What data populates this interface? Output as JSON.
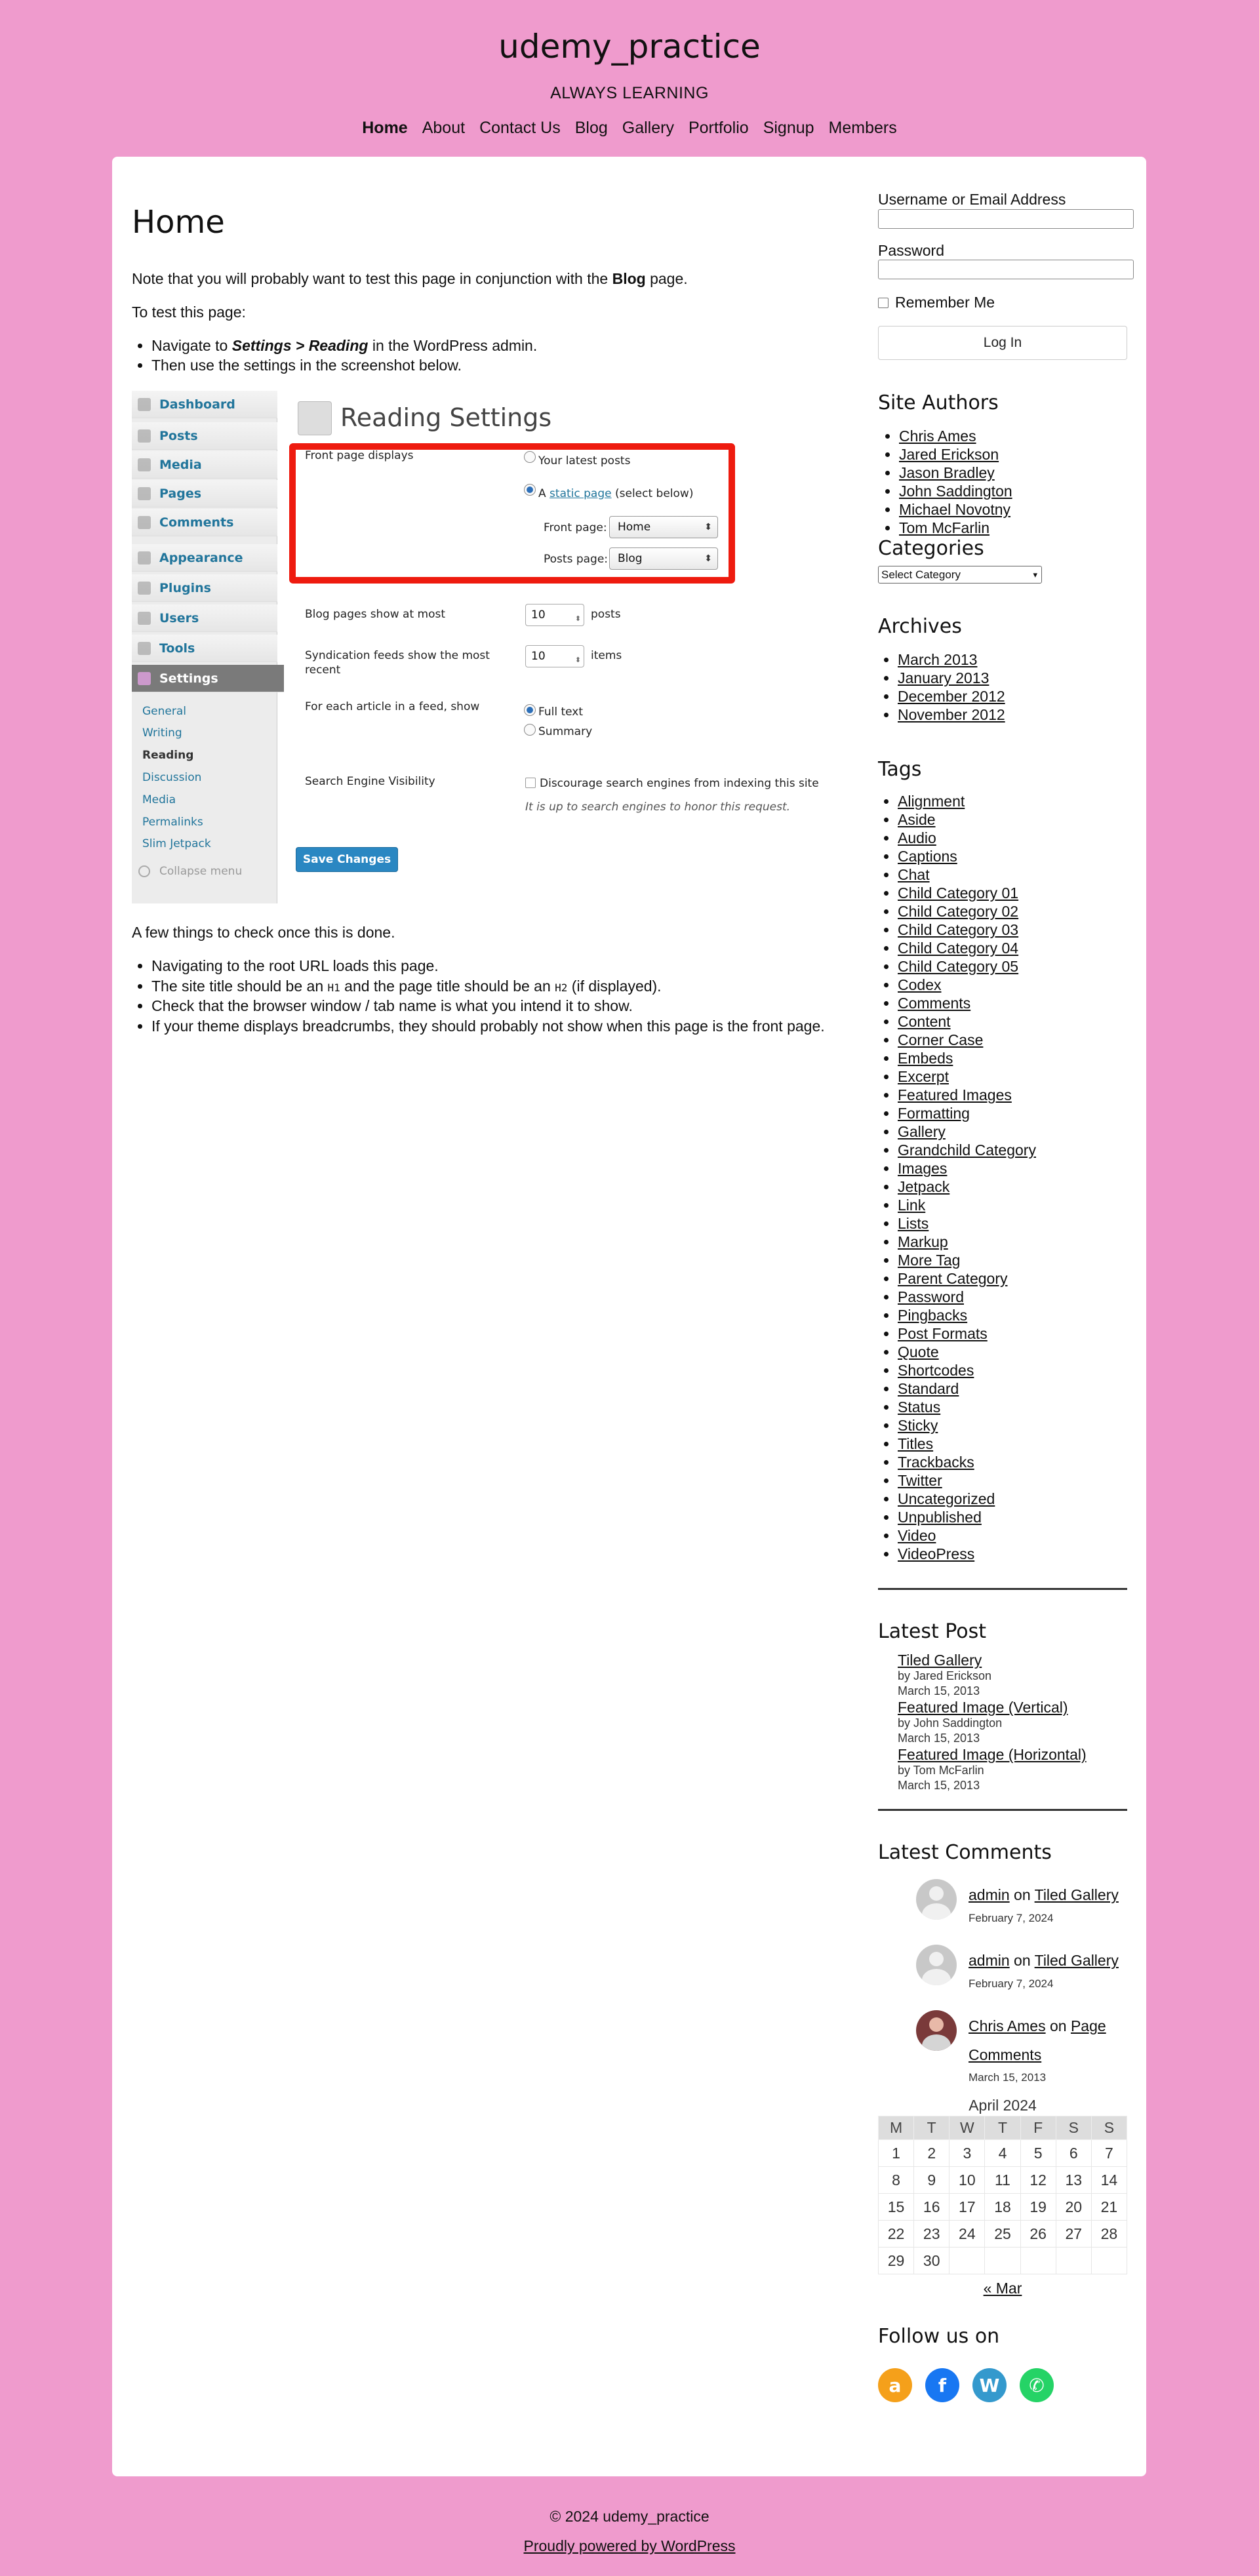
{
  "site": {
    "title": "udemy_practice",
    "tagline": "ALWAYS LEARNING",
    "nav": [
      "Home",
      "About",
      "Contact Us",
      "Blog",
      "Gallery",
      "Portfolio",
      "Signup",
      "Members"
    ]
  },
  "page": {
    "title": "Home",
    "intro_pre": "Note that you will probably want to test this page in conjunction with the ",
    "intro_bold": "Blog",
    "intro_post": " page.",
    "to_test": "To test this page:",
    "steps": {
      "s1_pre": "Navigate to ",
      "s1_bold": "Settings > Reading",
      "s1_post": " in the WordPress admin.",
      "s2": "Then use the settings in the screenshot below."
    },
    "after_shot": "A few things to check once this is done.",
    "checks": {
      "c1": "Navigating to the root URL loads this page.",
      "c2_a": "The site title should be an ",
      "c2_h1": "H1",
      "c2_b": " and the page title should be an ",
      "c2_h2": "H2",
      "c2_c": " (if displayed).",
      "c3": "Check that the browser window / tab name is what you intend it to show.",
      "c4": "If your theme displays breadcrumbs, they should probably not show when this page is the front page."
    }
  },
  "screenshot": {
    "menu": [
      "Dashboard",
      "Posts",
      "Media",
      "Pages",
      "Comments",
      "Appearance",
      "Plugins",
      "Users",
      "Tools",
      "Settings"
    ],
    "submenu": [
      "General",
      "Writing",
      "Reading",
      "Discussion",
      "Media",
      "Permalinks",
      "Slim Jetpack"
    ],
    "collapse": "Collapse menu",
    "heading": "Reading Settings",
    "front_page_displays": "Front page displays",
    "opt_latest": "Your latest posts",
    "opt_static_a": "A ",
    "opt_static_link": "static page",
    "opt_static_b": " (select below)",
    "front_page_label": "Front page:",
    "front_page_value": "Home",
    "posts_page_label": "Posts page:",
    "posts_page_value": "Blog",
    "blog_pages_label": "Blog pages show at most",
    "blog_pages_value": "10",
    "blog_pages_unit": "posts",
    "feeds_label": "Syndication feeds show the most recent",
    "feeds_value": "10",
    "feeds_unit": "items",
    "article_label": "For each article in a feed, show",
    "opt_full": "Full text",
    "opt_summary": "Summary",
    "visibility_label": "Search Engine Visibility",
    "visibility_check": "Discourage search engines from indexing this site",
    "visibility_note": "It is up to search engines to honor this request.",
    "save": "Save Changes"
  },
  "login": {
    "username_label": "Username or Email Address",
    "password_label": "Password",
    "remember": "Remember Me",
    "button": "Log In"
  },
  "authors": {
    "title": "Site Authors",
    "items": [
      "Chris Ames",
      "Jared Erickson",
      "Jason Bradley",
      "John Saddington",
      "Michael Novotny",
      "Tom McFarlin"
    ]
  },
  "categories": {
    "title": "Categories",
    "select": "Select Category"
  },
  "archives": {
    "title": "Archives",
    "items": [
      "March 2013",
      "January 2013",
      "December 2012",
      "November 2012"
    ]
  },
  "tags": {
    "title": "Tags",
    "items": [
      "Alignment",
      "Aside",
      "Audio",
      "Captions",
      "Chat",
      "Child Category 01",
      "Child Category 02",
      "Child Category 03",
      "Child Category 04",
      "Child Category 05",
      "Codex",
      "Comments",
      "Content",
      "Corner Case",
      "Embeds",
      "Excerpt",
      "Featured Images",
      "Formatting",
      "Gallery",
      "Grandchild Category",
      "Images",
      "Jetpack",
      "Link",
      "Lists",
      "Markup",
      "More Tag",
      "Parent Category",
      "Password",
      "Pingbacks",
      "Post Formats",
      "Quote",
      "Shortcodes",
      "Standard",
      "Status",
      "Sticky",
      "Titles",
      "Trackbacks",
      "Twitter",
      "Uncategorized",
      "Unpublished",
      "Video",
      "VideoPress"
    ]
  },
  "latest_post": {
    "title": "Latest Post",
    "items": [
      {
        "title": "Tiled Gallery",
        "by": "by Jared Erickson",
        "date": "March 15, 2013"
      },
      {
        "title": "Featured Image (Vertical)",
        "by": "by John Saddington",
        "date": "March 15, 2013"
      },
      {
        "title": "Featured Image (Horizontal)",
        "by": "by Tom McFarlin",
        "date": "March 15, 2013"
      }
    ]
  },
  "latest_comments": {
    "title": "Latest Comments",
    "on": "on",
    "items": [
      {
        "author": "admin",
        "post": "Tiled Gallery",
        "date": "February 7, 2024"
      },
      {
        "author": "admin",
        "post": "Tiled Gallery",
        "date": "February 7, 2024"
      },
      {
        "author": "Chris Ames",
        "post": "Page Comments",
        "date": "March 15, 2013"
      }
    ]
  },
  "calendar": {
    "caption": "April 2024",
    "days": [
      "M",
      "T",
      "W",
      "T",
      "F",
      "S",
      "S"
    ],
    "weeks": [
      [
        "1",
        "2",
        "3",
        "4",
        "5",
        "6",
        "7"
      ],
      [
        "8",
        "9",
        "10",
        "11",
        "12",
        "13",
        "14"
      ],
      [
        "15",
        "16",
        "17",
        "18",
        "19",
        "20",
        "21"
      ],
      [
        "22",
        "23",
        "24",
        "25",
        "26",
        "27",
        "28"
      ],
      [
        "29",
        "30",
        "",
        "",
        "",
        "",
        ""
      ]
    ],
    "prev": "« Mar"
  },
  "follow": {
    "title": "Follow us on",
    "icons": [
      {
        "name": "amazon-icon",
        "glyph": "a",
        "color": "#f5a01a"
      },
      {
        "name": "facebook-icon",
        "glyph": "f",
        "color": "#1877f2"
      },
      {
        "name": "wordpress-icon",
        "glyph": "W",
        "color": "#3499cd"
      },
      {
        "name": "whatsapp-icon",
        "glyph": "✆",
        "color": "#25d366"
      }
    ]
  },
  "footer": {
    "copyright": "© 2024 udemy_practice",
    "powered": "Proudly powered by WordPress"
  }
}
